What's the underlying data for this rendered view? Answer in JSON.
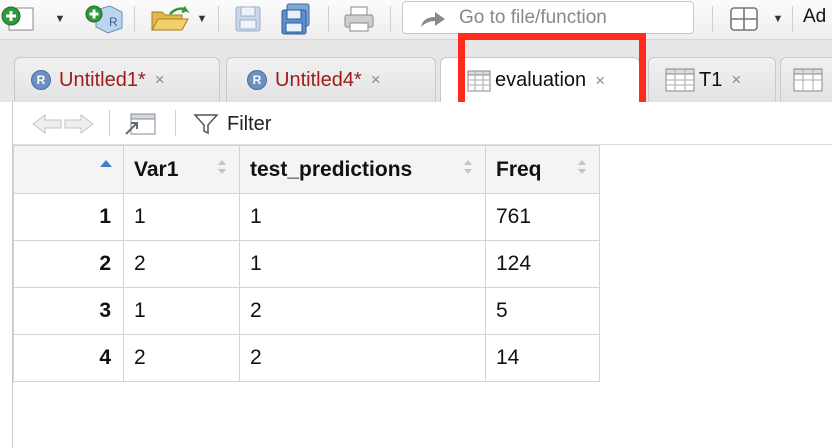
{
  "toolbar": {
    "goto_placeholder": "Go to file/function",
    "addins_label": "Ad"
  },
  "tabs": [
    {
      "label": "Untitled1*",
      "icon": "r-script-icon",
      "unsaved": true
    },
    {
      "label": "Untitled4*",
      "icon": "r-script-icon",
      "unsaved": true
    },
    {
      "label": "evaluation",
      "icon": "data-grid-icon",
      "active": true
    },
    {
      "label": "T1",
      "icon": "data-grid-icon"
    }
  ],
  "tab_close_glyph": "×",
  "r_badge": "R",
  "subbar": {
    "filter_label": "Filter"
  },
  "table": {
    "columns": [
      "Var1",
      "test_predictions",
      "Freq"
    ],
    "rows": [
      {
        "n": "1",
        "cells": [
          "1",
          "1",
          "761"
        ]
      },
      {
        "n": "2",
        "cells": [
          "2",
          "1",
          "124"
        ]
      },
      {
        "n": "3",
        "cells": [
          "1",
          "2",
          "5"
        ]
      },
      {
        "n": "4",
        "cells": [
          "2",
          "2",
          "14"
        ]
      }
    ]
  },
  "colors": {
    "highlight": "#ff2a1a",
    "unsaved_tab_text": "#a11a1a",
    "sort_accent": "#3d7fd1"
  }
}
